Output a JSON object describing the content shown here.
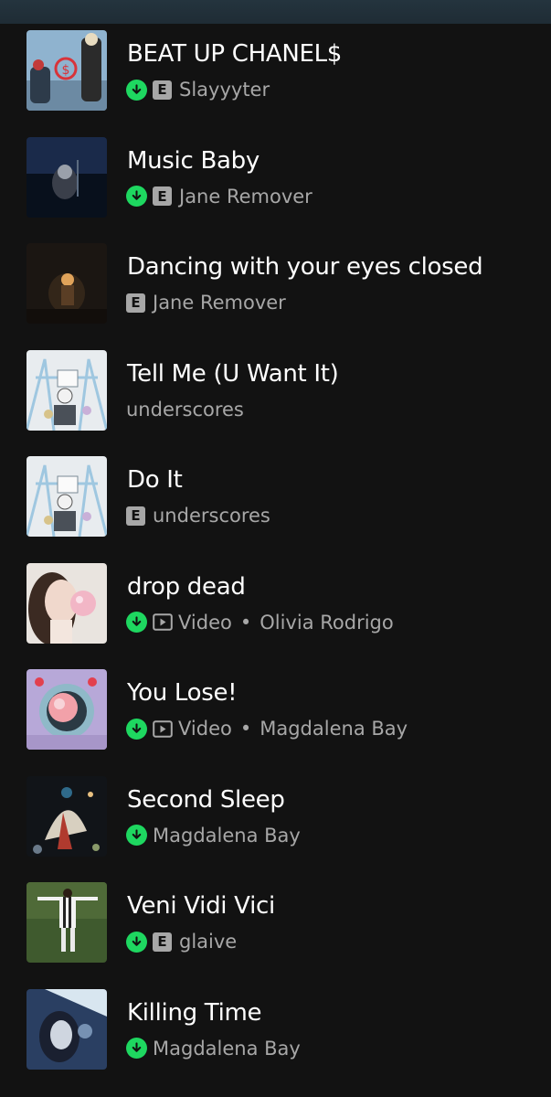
{
  "tracks": [
    {
      "title": "BEAT UP CHANEL$",
      "artist": "Slayyyter",
      "downloaded": true,
      "explicit": true,
      "video": false,
      "art_icon": "album-art-beat-up-chanel"
    },
    {
      "title": "Music Baby",
      "artist": "Jane Remover",
      "downloaded": true,
      "explicit": true,
      "video": false,
      "art_icon": "album-art-music-baby"
    },
    {
      "title": "Dancing with your eyes closed",
      "artist": "Jane Remover",
      "downloaded": false,
      "explicit": true,
      "video": false,
      "art_icon": "album-art-dancing"
    },
    {
      "title": "Tell Me (U Want It)",
      "artist": "underscores",
      "downloaded": false,
      "explicit": false,
      "video": false,
      "art_icon": "album-art-underscores"
    },
    {
      "title": "Do It",
      "artist": "underscores",
      "downloaded": false,
      "explicit": true,
      "video": false,
      "art_icon": "album-art-underscores"
    },
    {
      "title": "drop dead",
      "artist": "Olivia Rodrigo",
      "downloaded": true,
      "explicit": false,
      "video": true,
      "video_label": "Video",
      "art_icon": "album-art-drop-dead"
    },
    {
      "title": "You Lose!",
      "artist": "Magdalena Bay",
      "downloaded": true,
      "explicit": false,
      "video": true,
      "video_label": "Video",
      "art_icon": "album-art-you-lose"
    },
    {
      "title": "Second Sleep",
      "artist": "Magdalena Bay",
      "downloaded": true,
      "explicit": false,
      "video": false,
      "art_icon": "album-art-second-sleep"
    },
    {
      "title": "Veni Vidi Vici",
      "artist": "glaive",
      "downloaded": true,
      "explicit": true,
      "video": false,
      "art_icon": "album-art-veni-vidi-vici"
    },
    {
      "title": "Killing Time",
      "artist": "Magdalena Bay",
      "downloaded": true,
      "explicit": false,
      "video": false,
      "art_icon": "album-art-killing-time"
    }
  ],
  "labels": {
    "explicit_badge": "E",
    "separator": "•"
  },
  "colors": {
    "background": "#121212",
    "title": "#ffffff",
    "subtitle": "#a7a7a7",
    "download_accent": "#1ed760"
  }
}
